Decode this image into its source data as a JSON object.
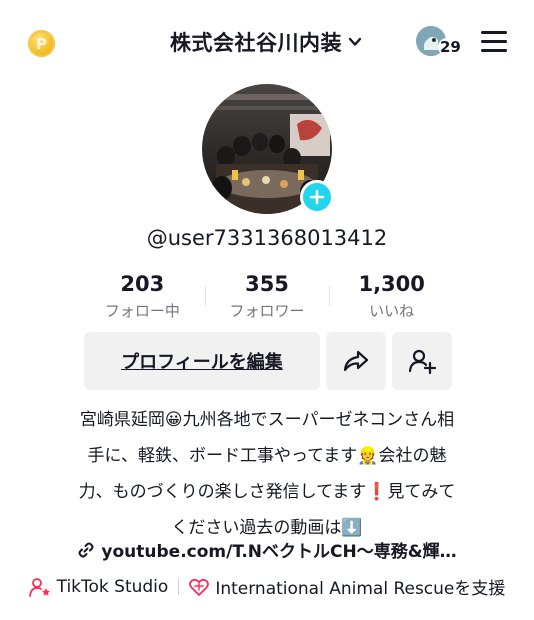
{
  "header": {
    "coin_icon": "coin-icon",
    "coin_glyph": "P",
    "account_name": "株式会社谷川内装",
    "notification_count": "29"
  },
  "profile": {
    "username": "@user7331368013412"
  },
  "stats": [
    {
      "value": "203",
      "label": "フォロー中"
    },
    {
      "value": "355",
      "label": "フォロワー"
    },
    {
      "value": "1,300",
      "label": "いいね"
    }
  ],
  "actions": {
    "edit_label": "プロフィールを編集",
    "share_icon": "share-icon",
    "add_friend_icon": "add-friend-icon"
  },
  "bio": {
    "lines": [
      "宮崎県延岡😀九州各地でスーパーゼネコンさん相",
      "手に、軽鉄、ボード工事やってます👷会社の魅",
      "力、ものづくりの楽しさ発信してます❗見てみて",
      "ください過去の動画は⬇️"
    ],
    "link": "youtube.com/T.NベクトルCH～専務&輝…"
  },
  "bottom": {
    "studio_label": "TikTok Studio",
    "charity_label": "International Animal Rescueを支援"
  },
  "colors": {
    "accent_cyan": "#20d5ec",
    "charity_pink": "#fe2c55",
    "text": "#161823",
    "muted": "#757580",
    "button_bg": "#f1f1f2"
  }
}
